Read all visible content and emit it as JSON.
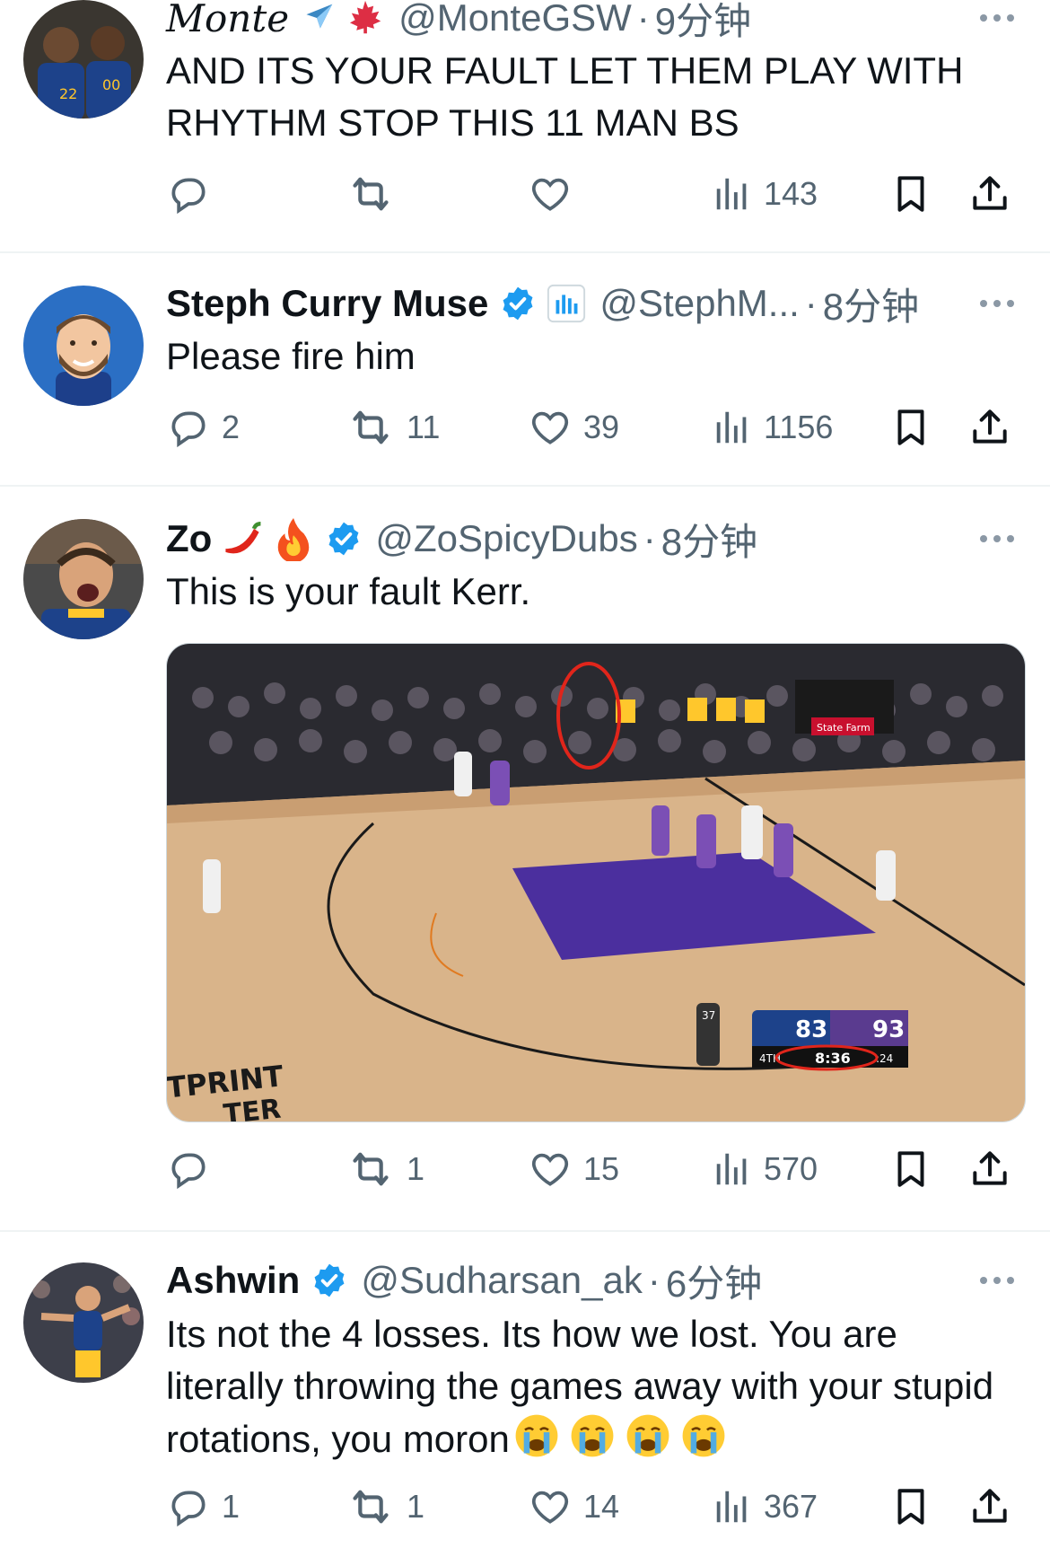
{
  "tweets": [
    {
      "name": "Monte",
      "name_emojis": [
        "airplane-emoji",
        "maple-leaf-emoji"
      ],
      "handle": "@MonteGSW",
      "dot": "·",
      "time": "9分钟",
      "text": "AND ITS YOUR FAULT LET THEM PLAY WITH RHYTHM STOP THIS 11 MAN BS",
      "replies": "",
      "retweets": "",
      "likes": "",
      "views": "143"
    },
    {
      "name": "Steph Curry Muse",
      "verified": true,
      "handle": "@StephM...",
      "dot": "·",
      "time": "8分钟",
      "text": "Please fire him",
      "replies": "2",
      "retweets": "11",
      "likes": "39",
      "views": "1156"
    },
    {
      "name": "Zo",
      "name_emojis": [
        "chili-pepper-emoji",
        "fire-emoji"
      ],
      "verified": true,
      "handle": "@ZoSpicyDubs",
      "dot": "·",
      "time": "8分钟",
      "text": "This is your fault Kerr.",
      "replies": "",
      "retweets": "1",
      "likes": "15",
      "views": "570",
      "media": {
        "scoreboard": {
          "home_score": "83",
          "away_score": "93",
          "quarter": "4TH",
          "clock": "8:36",
          "shot_clock": ":24"
        },
        "court_text": [
          "TPRINT",
          "TER"
        ],
        "referee_number": "37"
      }
    },
    {
      "name": "Ashwin",
      "verified": true,
      "handle": "@Sudharsan_ak",
      "dot": "·",
      "time": "6分钟",
      "text": "Its not the 4 losses. Its how we lost. You are literally throwing the games away with your stupid rotations, you moron",
      "text_emojis": [
        "crying-face-emoji",
        "crying-face-emoji",
        "crying-face-emoji",
        "crying-face-emoji"
      ],
      "replies": "1",
      "retweets": "1",
      "likes": "14",
      "views": "367"
    }
  ],
  "colors": {
    "text": "#0f1419",
    "secondary": "#536471",
    "verified": "#1d9bf0",
    "divider": "#eff3f4",
    "court_paint": "#4b2f9e",
    "warriors_blue": "#1d428a",
    "warriors_gold": "#ffc72c"
  }
}
